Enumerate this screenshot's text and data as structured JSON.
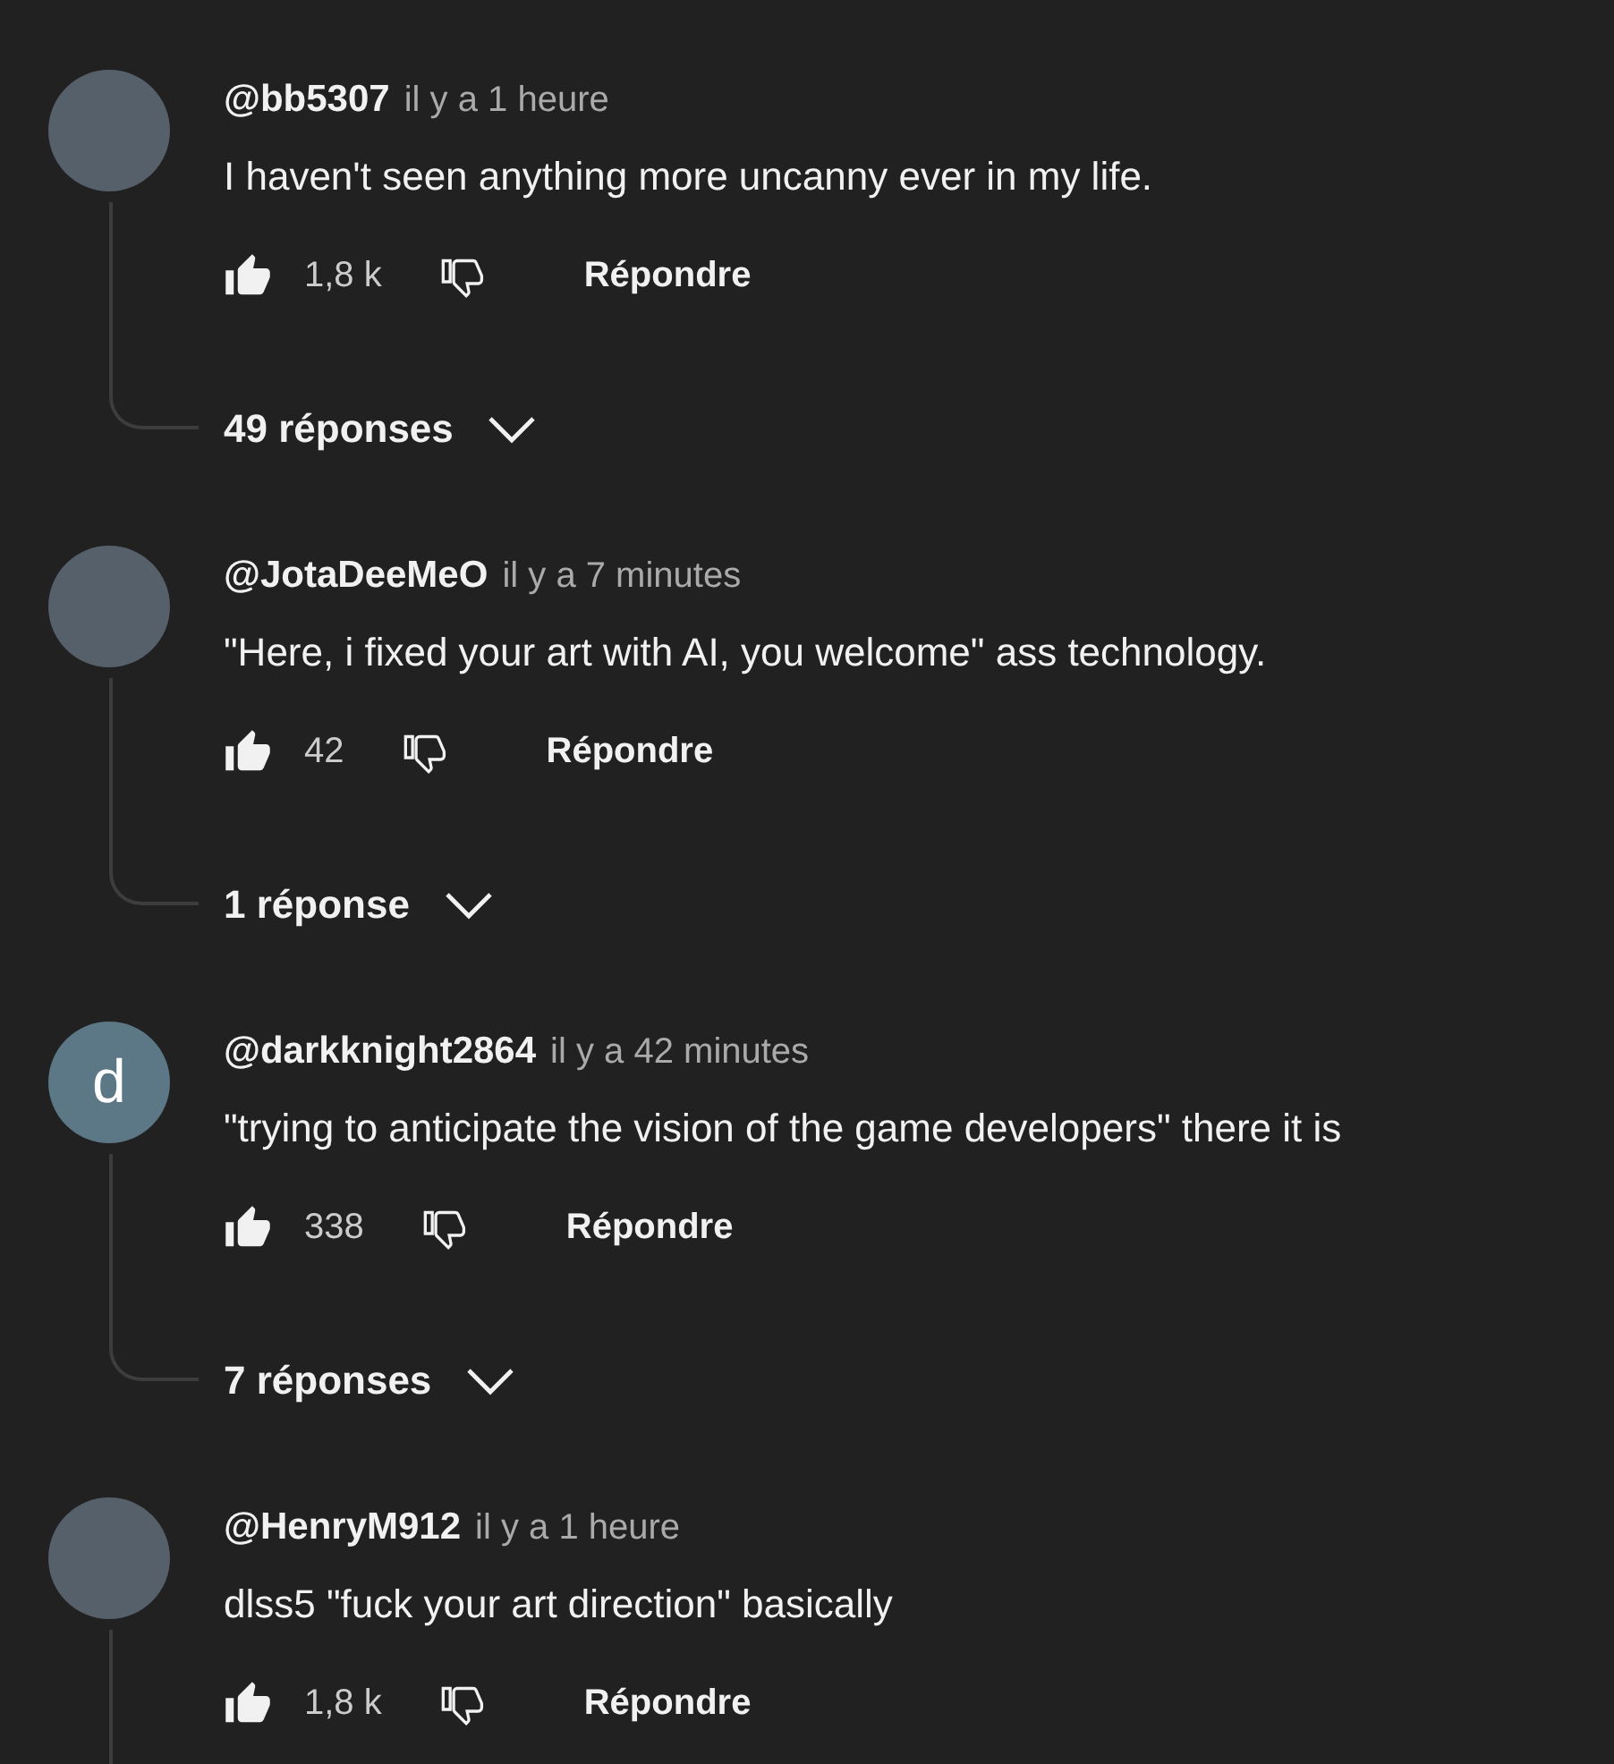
{
  "comments": [
    {
      "avatar": {
        "kind": "image"
      },
      "username": "@bb5307",
      "time": "il y a 1 heure",
      "text": "I haven't seen anything more uncanny ever in my life.",
      "liked": true,
      "likes": "1,8 k",
      "reply_label": "Répondre",
      "replies_label": "49 réponses"
    },
    {
      "avatar": {
        "kind": "image"
      },
      "username": "@JotaDeeMeO",
      "time": "il y a 7 minutes",
      "text": "\"Here, i fixed your art with AI, you welcome\" ass technology.",
      "liked": true,
      "likes": "42",
      "reply_label": "Répondre",
      "replies_label": "1 réponse"
    },
    {
      "avatar": {
        "kind": "letter",
        "letter": "d",
        "color": "#5c7785"
      },
      "username": "@darkknight2864",
      "time": "il y a 42 minutes",
      "text": "\"trying to anticipate the vision of the game developers\" there it is",
      "liked": true,
      "likes": "338",
      "reply_label": "Répondre",
      "replies_label": "7 réponses"
    },
    {
      "avatar": {
        "kind": "image"
      },
      "username": "@HenryM912",
      "time": "il y a 1 heure",
      "text": "dlss5 \"fuck your art direction\" basically",
      "liked": true,
      "likes": "1,8 k",
      "reply_label": "Répondre"
    }
  ]
}
